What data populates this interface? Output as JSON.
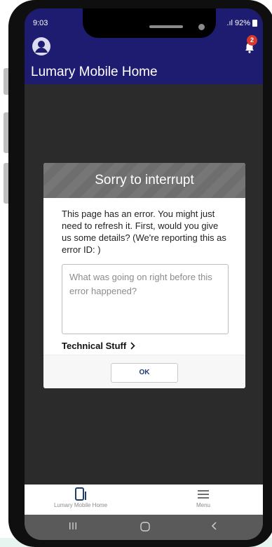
{
  "status": {
    "time": "9:03",
    "signal": ".ıl",
    "battery": "92%"
  },
  "notifications": {
    "count": "2"
  },
  "header": {
    "title": "Lumary Mobile Home"
  },
  "dialog": {
    "title": "Sorry to interrupt",
    "message": "This page has an error. You might just need to refresh it. First, would you give us some details? (We're reporting this as error ID: )",
    "textarea_placeholder": "What was going on right before this error happened?",
    "technical_label": "Technical Stuff",
    "ok_label": "OK"
  },
  "bottom_nav": [
    {
      "label": "Lumary Mobile Home",
      "icon": "mobile-icon"
    },
    {
      "label": "Menu",
      "icon": "hamburger-menu-icon"
    }
  ],
  "colors": {
    "header_bg": "#1e1c70",
    "dialog_header_bg": "#6e6e6e",
    "nav_accent": "#1f3a6e",
    "badge": "#d63a2e"
  }
}
